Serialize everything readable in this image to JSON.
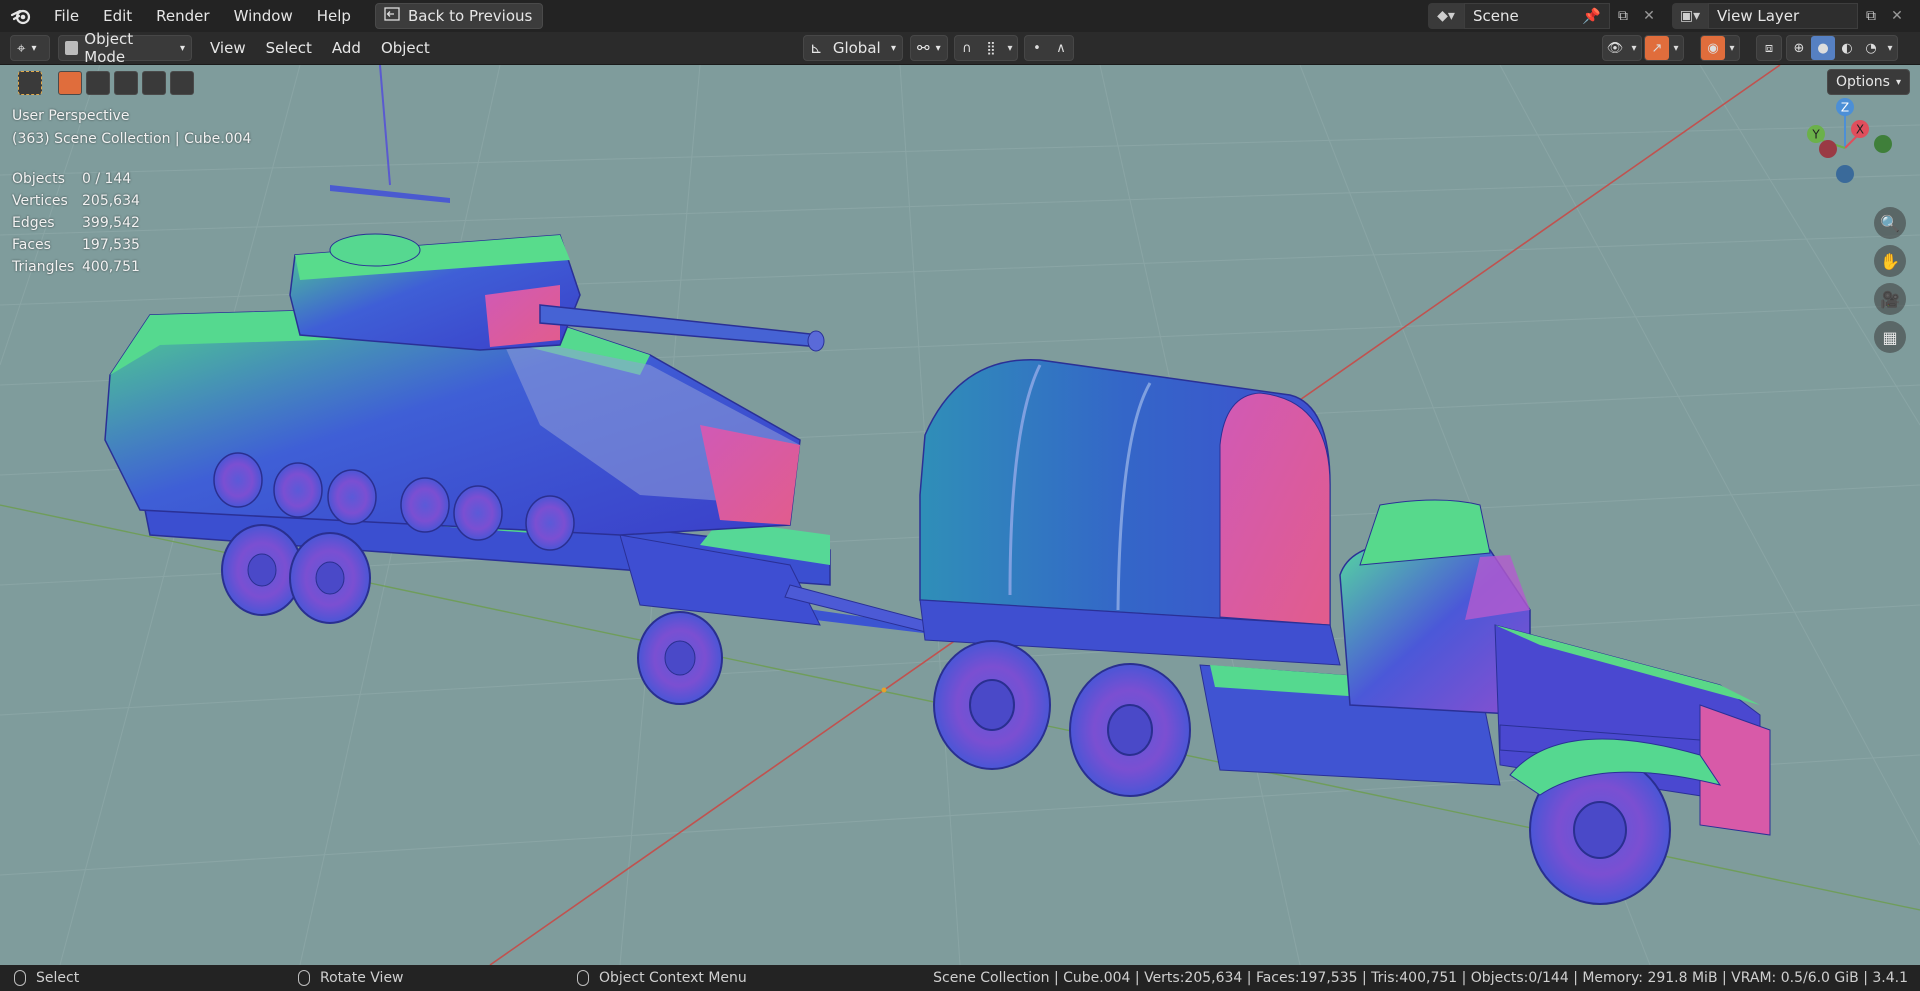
{
  "menubar": {
    "items": [
      "File",
      "Edit",
      "Render",
      "Window",
      "Help"
    ],
    "back_label": "Back to Previous",
    "scene_label": "Scene",
    "view_layer_label": "View Layer"
  },
  "header": {
    "mode_label": "Object Mode",
    "menus": [
      "View",
      "Select",
      "Add",
      "Object"
    ],
    "transform_orientation": "Global"
  },
  "viewport": {
    "perspective_label": "User Perspective",
    "collection_label": "(363) Scene Collection | Cube.004",
    "stats": [
      {
        "key": "Objects",
        "value": "0 / 144"
      },
      {
        "key": "Vertices",
        "value": "205,634"
      },
      {
        "key": "Edges",
        "value": "399,542"
      },
      {
        "key": "Faces",
        "value": "197,535"
      },
      {
        "key": "Triangles",
        "value": "400,751"
      }
    ],
    "options_label": "Options",
    "gizmo_axes": {
      "z": "Z",
      "y": "Y",
      "x": "X"
    }
  },
  "statusbar": {
    "select_label": "Select",
    "rotate_label": "Rotate View",
    "context_label": "Object Context Menu",
    "stats_text": "Scene Collection | Cube.004 | Verts:205,634 | Faces:197,535 | Tris:400,751 | Objects:0/144 | Memory: 291.8 MiB | VRAM: 0.5/6.0 GiB | 3.4.1"
  },
  "colors": {
    "viewport_bg": "#7f9c9c",
    "accent_orange": "#e06d3c",
    "axis_x": "#e04e5c",
    "axis_y": "#6bb14a",
    "axis_z": "#4c8fd6"
  }
}
